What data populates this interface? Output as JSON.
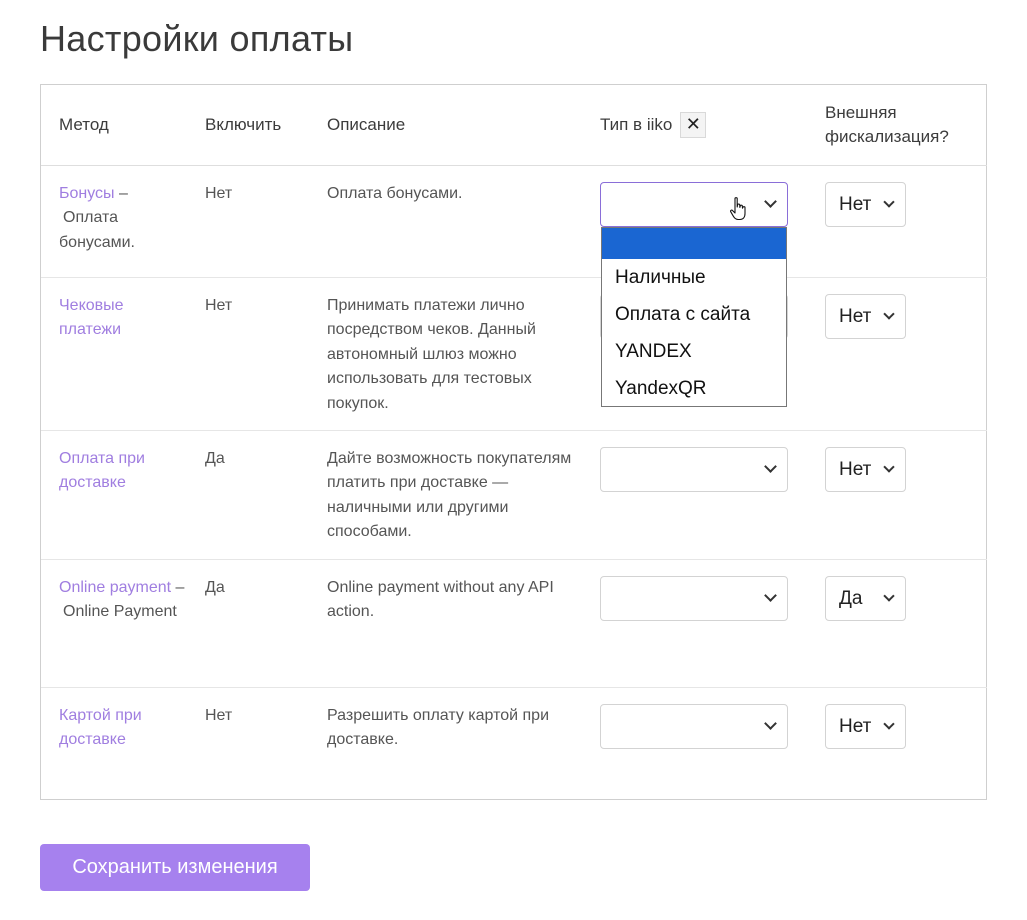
{
  "page_title": "Настройки оплаты",
  "table": {
    "headers": {
      "method": "Метод",
      "enable": "Включить",
      "description": "Описание",
      "iiko_type": "Тип в iiko",
      "iiko_clear": "✕",
      "fiscal_line1": "Внешняя",
      "fiscal_line2": "фискализация?"
    },
    "rows": [
      {
        "name": "Бонусы",
        "sep": " –",
        "name_extra": "Оплата бонусами.",
        "enabled": "Нет",
        "description": "Оплата бонусами.",
        "iiko_value": "",
        "fiscal": "Нет"
      },
      {
        "name": "Чековые платежи",
        "sep": "",
        "name_extra": "",
        "enabled": "Нет",
        "description": "Принимать платежи лично посредством чеков. Данный автономный шлюз можно использовать для тестовых покупок.",
        "iiko_value": "",
        "fiscal": "Нет"
      },
      {
        "name": "Оплата при доставке",
        "sep": "",
        "name_extra": "",
        "enabled": "Да",
        "description": "Дайте возможность покупателям платить при доставке — наличными или другими способами.",
        "iiko_value": "",
        "fiscal": "Нет"
      },
      {
        "name": "Online payment",
        "sep": " –",
        "name_extra": "Online Payment",
        "enabled": "Да",
        "description": "Online payment without any API action.",
        "iiko_value": "",
        "fiscal": "Да"
      },
      {
        "name": "Картой при доставке",
        "sep": "",
        "name_extra": "",
        "enabled": "Нет",
        "description": "Разрешить оплату картой при доставке.",
        "iiko_value": "",
        "fiscal": "Нет"
      }
    ]
  },
  "dropdown": {
    "options": [
      "",
      "Наличные",
      "Оплата с сайта",
      "YANDEX",
      "YandexQR"
    ],
    "selected_index": 0
  },
  "save_button_label": "Сохранить изменения",
  "colors": {
    "accent": "#a681ee",
    "link": "#a07ee0",
    "highlight": "#1a66d2"
  }
}
